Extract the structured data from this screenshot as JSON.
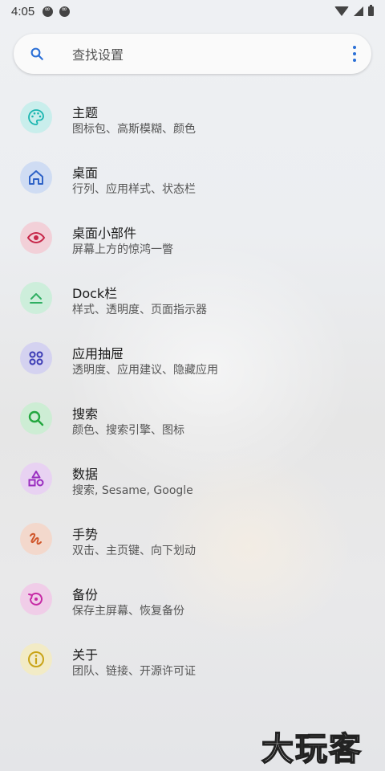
{
  "status_bar": {
    "time": "4:05"
  },
  "search": {
    "placeholder": "查找设置"
  },
  "items": [
    {
      "title": "主题",
      "subtitle": "图标包、高斯模糊、颜色",
      "icon": "palette-icon",
      "accent": "#1bb6b0",
      "bg": "#c9eeec"
    },
    {
      "title": "桌面",
      "subtitle": "行列、应用样式、状态栏",
      "icon": "home-icon",
      "accent": "#2f63c7",
      "bg": "#cfdcf3"
    },
    {
      "title": "桌面小部件",
      "subtitle": "屏幕上方的惊鸿一瞥",
      "icon": "eye-icon",
      "accent": "#c7284a",
      "bg": "#f2d0d8"
    },
    {
      "title": "Dock栏",
      "subtitle": "样式、透明度、页面指示器",
      "icon": "dock-icon",
      "accent": "#2fae62",
      "bg": "#cdeedb"
    },
    {
      "title": "应用抽屉",
      "subtitle": "透明度、应用建议、隐藏应用",
      "icon": "apps-grid-icon",
      "accent": "#3b3bb5",
      "bg": "#d4d2f0"
    },
    {
      "title": "搜索",
      "subtitle": "颜色、搜索引擎、图标",
      "icon": "search-icon",
      "accent": "#23a73f",
      "bg": "#cdedd4"
    },
    {
      "title": "数据",
      "subtitle": "搜索, Sesame, Google",
      "icon": "shapes-icon",
      "accent": "#9a2fc0",
      "bg": "#e8d2f2"
    },
    {
      "title": "手势",
      "subtitle": "双击、主页键、向下划动",
      "icon": "gesture-icon",
      "accent": "#d0562b",
      "bg": "#f3d8cc"
    },
    {
      "title": "备份",
      "subtitle": "保存主屏幕、恢复备份",
      "icon": "restore-icon",
      "accent": "#c72aa5",
      "bg": "#f0cde8"
    },
    {
      "title": "关于",
      "subtitle": "团队、链接、开源许可证",
      "icon": "info-icon",
      "accent": "#c9a417",
      "bg": "#f2ebc6"
    }
  ],
  "watermark": "大玩客"
}
